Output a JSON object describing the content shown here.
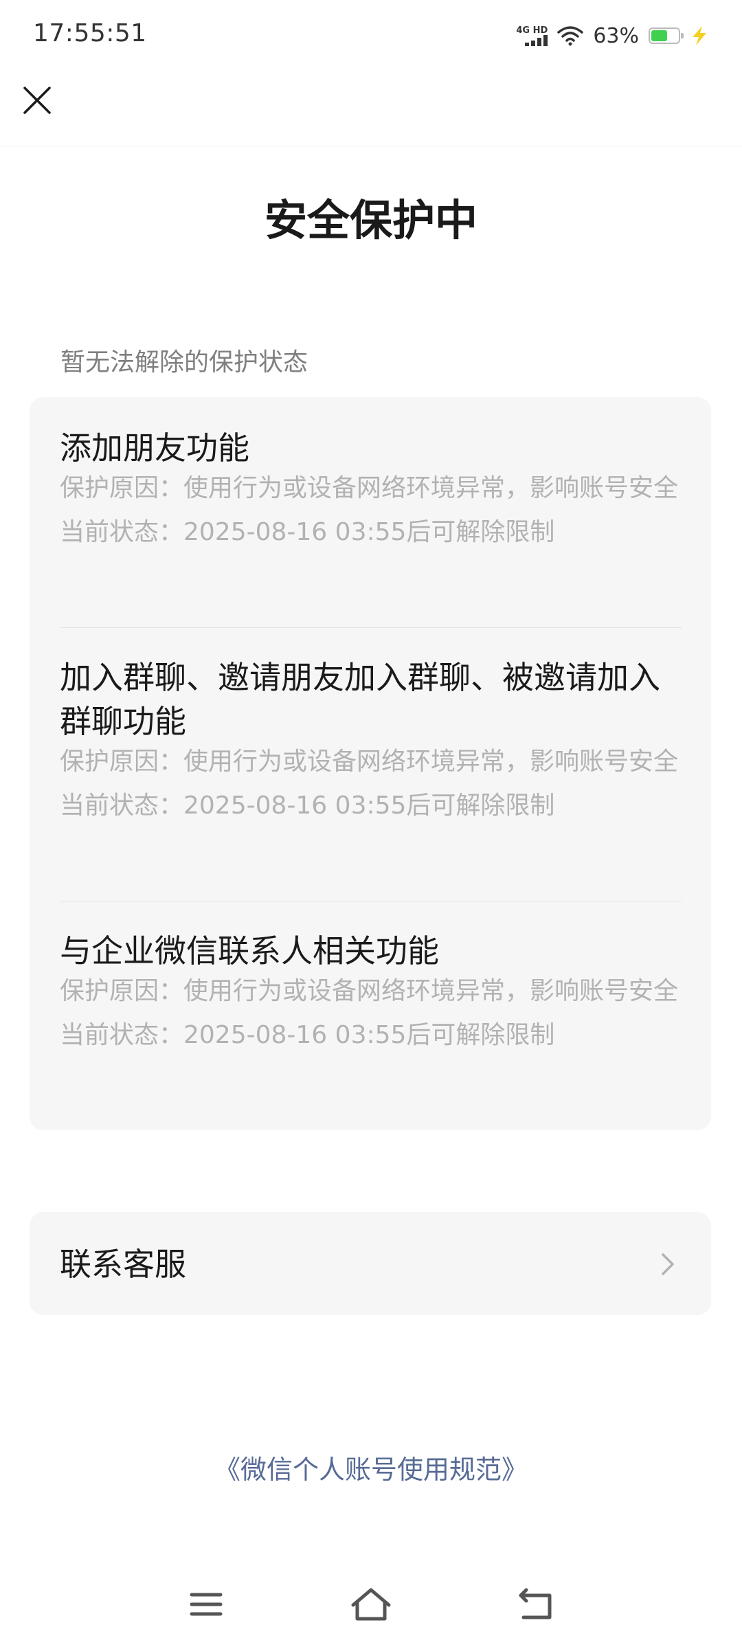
{
  "status_bar": {
    "time": "17:55:51",
    "network": "4G HD",
    "battery_percent": "63%",
    "battery_level": 0.63,
    "battery_color": "#3fd14e",
    "charging_color": "#f5d020"
  },
  "header": {
    "close_icon": "close-icon",
    "title": "安全保护中"
  },
  "section": {
    "label": "暂无法解除的保护状态"
  },
  "items": [
    {
      "title": "添加朋友功能",
      "reason": "保护原因：使用行为或设备网络环境异常，影响账号安全",
      "status": "当前状态：2025-08-16 03:55后可解除限制"
    },
    {
      "title": "加入群聊、邀请朋友加入群聊、被邀请加入群聊功能",
      "reason": "保护原因：使用行为或设备网络环境异常，影响账号安全",
      "status": "当前状态：2025-08-16 03:55后可解除限制"
    },
    {
      "title": "与企业微信联系人相关功能",
      "reason": "保护原因：使用行为或设备网络环境异常，影响账号安全",
      "status": "当前状态：2025-08-16 03:55后可解除限制"
    }
  ],
  "service": {
    "label": "联系客服",
    "icon": "chevron-right-icon"
  },
  "footer": {
    "policy_link": "《微信个人账号使用规范》",
    "link_color": "#576b95"
  },
  "nav": {
    "menu_icon": "menu-icon",
    "home_icon": "home-icon",
    "back_icon": "back-icon"
  }
}
